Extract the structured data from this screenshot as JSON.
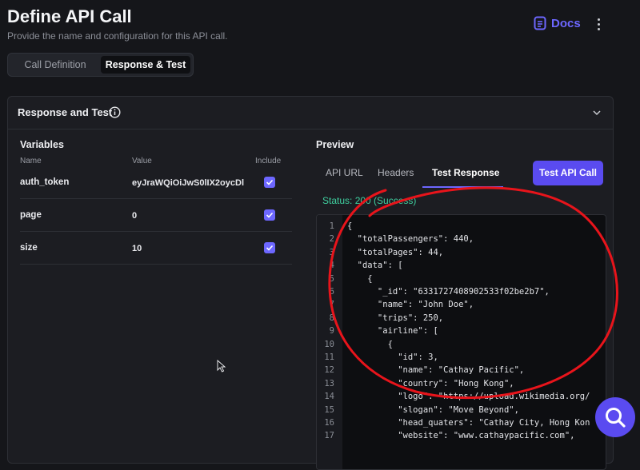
{
  "header": {
    "title": "Define API Call",
    "subtitle": "Provide the name and configuration for this API call.",
    "docs_label": "Docs"
  },
  "tabs": [
    "Call Definition",
    "Response & Test"
  ],
  "section": {
    "title": "Response and Test"
  },
  "variables": {
    "heading": "Variables",
    "columns": [
      "Name",
      "Value",
      "Include"
    ],
    "rows": [
      {
        "name": "auth_token",
        "value": "eyJraWQiOiJwS0lIX2oycDl",
        "include": true
      },
      {
        "name": "page",
        "value": "0",
        "include": true
      },
      {
        "name": "size",
        "value": "10",
        "include": true
      }
    ]
  },
  "preview": {
    "heading": "Preview",
    "tabs": [
      "API URL",
      "Headers",
      "Test Response"
    ],
    "active_tab": "Test Response",
    "test_button": "Test API Call",
    "status": "Status:  200 (Success)"
  },
  "code_lines": [
    {
      "n": "1",
      "t": "{"
    },
    {
      "n": "2",
      "t": "  \"totalPassengers\": 440,"
    },
    {
      "n": "3",
      "t": "  \"totalPages\": 44,"
    },
    {
      "n": "4",
      "t": "  \"data\": ["
    },
    {
      "n": "5",
      "t": "    {"
    },
    {
      "n": "6",
      "t": "      \"_id\": \"6331727408902533f02be2b7\","
    },
    {
      "n": "7",
      "t": "      \"name\": \"John Doe\","
    },
    {
      "n": "8",
      "t": "      \"trips\": 250,"
    },
    {
      "n": "9",
      "t": "      \"airline\": ["
    },
    {
      "n": "10",
      "t": "        {"
    },
    {
      "n": "11",
      "t": "          \"id\": 3,"
    },
    {
      "n": "12",
      "t": "          \"name\": \"Cathay Pacific\","
    },
    {
      "n": "13",
      "t": "          \"country\": \"Hong Kong\","
    },
    {
      "n": "14",
      "t": "          \"logo\": \"https://upload.wikimedia.org/"
    },
    {
      "n": "15",
      "t": "          \"slogan\": \"Move Beyond\","
    },
    {
      "n": "16",
      "t": "          \"head_quaters\": \"Cathay City, Hong Kon"
    },
    {
      "n": "17",
      "t": "          \"website\": \"www.cathaypacific.com\","
    }
  ],
  "colors": {
    "accent": "#6d67ff",
    "button": "#5a4bf0",
    "success": "#3fcf9f",
    "annotation": "#e8141b"
  },
  "icons": [
    "docs-icon",
    "kebab-menu-icon",
    "info-icon",
    "chevron-down-icon",
    "checkbox-check-icon",
    "mouse-cursor-icon",
    "search-icon"
  ]
}
